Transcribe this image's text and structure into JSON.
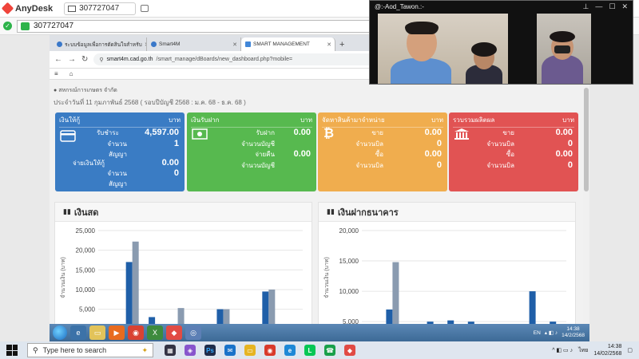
{
  "anydesk": {
    "app_name": "AnyDesk",
    "session_tab": "307727047",
    "address_value": "307727047"
  },
  "browser": {
    "tabs": [
      {
        "label": "ระบบข้อมูลเพื่อการตัดสินใจสำหรับ",
        "active": false
      },
      {
        "label": "Smart4M",
        "active": false
      },
      {
        "label": "SMART MANAGEMENT",
        "active": true
      }
    ],
    "url_host": "smart4m.cad.go.th",
    "url_path": "/smart_manage/dBoards/new_dashboard.php?mobile="
  },
  "dashboard": {
    "breadcrumb": "สหกรณ์การเกษตร จำกัด",
    "period": "ประจำวันที่ 11 กุมภาพันธ์ 2568 ( รอบปีบัญชี 2568 : ม.ค. 68 - ธ.ค. 68 )",
    "cards": [
      {
        "title": "เงินให้กู้",
        "unit": "บาท",
        "icon": "credit-card-icon",
        "color": "#3a7cc4",
        "rows": [
          {
            "label": "รับชำระ",
            "value": "4,597.00"
          },
          {
            "label": "จำนวน สัญญา",
            "value": "1"
          },
          {
            "label": "จ่ายเงินให้กู้",
            "value": "0.00"
          },
          {
            "label": "จำนวน สัญญา",
            "value": "0"
          }
        ]
      },
      {
        "title": "เงินรับฝาก",
        "unit": "บาท",
        "icon": "banknote-icon",
        "color": "#57b94f",
        "rows": [
          {
            "label": "รับฝาก",
            "value": "0.00"
          },
          {
            "label": "จำนวนบัญชี",
            "value": ""
          },
          {
            "label": "จ่ายคืน",
            "value": "0.00"
          },
          {
            "label": "จำนวนบัญชี",
            "value": ""
          }
        ]
      },
      {
        "title": "จัดหาสินค้ามาจำหน่าย",
        "unit": "บาท",
        "icon": "bitcoin-icon",
        "color": "#f0ad4e",
        "rows": [
          {
            "label": "ขาย",
            "value": "0.00"
          },
          {
            "label": "จำนวนบิล",
            "value": "0"
          },
          {
            "label": "ซื้อ",
            "value": "0.00"
          },
          {
            "label": "จำนวนบิล",
            "value": "0"
          }
        ]
      },
      {
        "title": "รวบรวมผลิตผล",
        "unit": "บาท",
        "icon": "bank-icon",
        "color": "#e15353",
        "rows": [
          {
            "label": "ขาย",
            "value": "0.00"
          },
          {
            "label": "จำนวนบิล",
            "value": "0"
          },
          {
            "label": "ซื้อ",
            "value": "0.00"
          },
          {
            "label": "จำนวนบิล",
            "value": "0"
          }
        ]
      }
    ]
  },
  "chart_data": [
    {
      "type": "bar",
      "title": "เงินสด",
      "ylabel": "จำนวนเงิน (บาท)",
      "ylim": [
        0,
        25000
      ],
      "yticks": [
        "25,000",
        "20,000",
        "15,000",
        "10,000",
        "5,000"
      ],
      "series": [
        {
          "color": "#1f5fa8",
          "values": [
            800,
            17000,
            3000,
            0,
            800,
            5000,
            0,
            9500,
            0
          ]
        },
        {
          "color": "#8a9bb0",
          "values": [
            0,
            22200,
            0,
            5300,
            0,
            5000,
            0,
            10000,
            800
          ]
        }
      ]
    },
    {
      "type": "bar",
      "title": "เงินฝากธนาคาร",
      "ylabel": "จำนวนเงิน (บาท)",
      "ylim": [
        0,
        20000
      ],
      "yticks": [
        "20,000",
        "15,000",
        "10,000",
        "5,000"
      ],
      "series": [
        {
          "color": "#1f5fa8",
          "values": [
            0,
            7000,
            0,
            5000,
            5200,
            5000,
            0,
            0,
            10000,
            5000
          ]
        },
        {
          "color": "#8a9bb0",
          "values": [
            800,
            14800,
            0,
            0,
            0,
            1500,
            0,
            0,
            0,
            0
          ]
        }
      ]
    }
  ],
  "video": {
    "caller": "@:-Aod_Tawon.:-"
  },
  "remote_taskbar": {
    "lang": "EN",
    "time": "14:38",
    "date": "14/2/2568"
  },
  "host_taskbar": {
    "search_placeholder": "Type here to search",
    "lang": "ไทย",
    "time": "14:38",
    "date": "14/02/2568"
  }
}
